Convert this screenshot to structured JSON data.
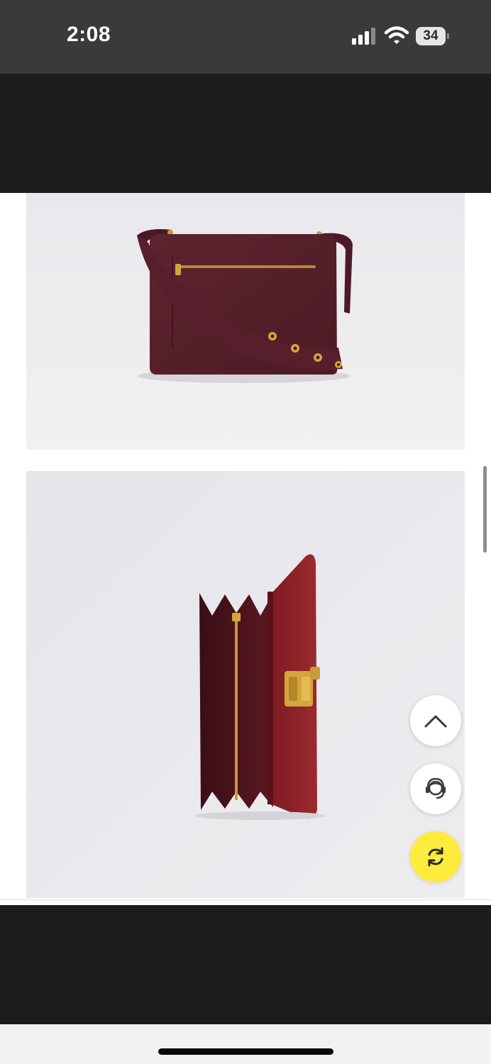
{
  "status_bar": {
    "time": "2:08",
    "battery_level": "34",
    "icons": [
      "signal-icon",
      "wifi-icon",
      "battery-icon"
    ]
  },
  "product_images": [
    {
      "name": "bag-back-view-image",
      "description_icon": "bag-image"
    },
    {
      "name": "bag-open-top-view-image",
      "description_icon": "bag-image"
    }
  ],
  "floating_buttons": [
    {
      "name": "scroll-to-top-button",
      "icon": "chevron-up-icon"
    },
    {
      "name": "customer-support-button",
      "icon": "headset-agent-icon"
    },
    {
      "name": "refresh-button",
      "icon": "refresh-icon"
    }
  ],
  "colors": {
    "status_bar_bg": "#3a3a3c",
    "dark_band": "#1c1c1f",
    "bag_burgundy": "#5a1e29",
    "bag_red_interior": "#8a1e24",
    "gold_hardware": "#d4a63a",
    "refresh_button_yellow": "#ffeb3b"
  }
}
